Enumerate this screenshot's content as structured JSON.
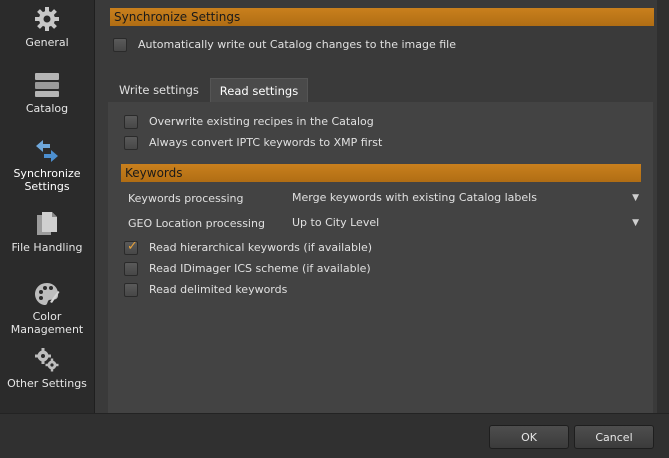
{
  "sidebar": {
    "items": [
      {
        "label": "General",
        "icon": "gear-icon"
      },
      {
        "label": "Catalog",
        "icon": "database-icon"
      },
      {
        "label": "Synchronize Settings",
        "line1": "Synchronize",
        "line2": "Settings",
        "icon": "sync-arrows-icon"
      },
      {
        "label": "File Handling",
        "icon": "files-icon"
      },
      {
        "label": "Color Management",
        "line1": "Color",
        "line2": "Management",
        "icon": "palette-icon"
      },
      {
        "label": "Other Settings",
        "icon": "gears-icon"
      }
    ]
  },
  "main": {
    "header": "Synchronize Settings",
    "auto_write_label": "Automatically write out Catalog changes to the image file",
    "auto_write_checked": false,
    "tabs": [
      {
        "label": "Write settings",
        "active": false
      },
      {
        "label": "Read settings",
        "active": true
      }
    ],
    "read": {
      "overwrite_label": "Overwrite existing recipes in the Catalog",
      "overwrite_checked": false,
      "convert_label": "Always convert IPTC keywords to XMP first",
      "convert_checked": false,
      "keywords_header": "Keywords",
      "keywords_processing_label": "Keywords processing",
      "keywords_processing_value": "Merge keywords with existing Catalog labels",
      "geo_label": "GEO Location processing",
      "geo_value": "Up to City Level",
      "hierarchical_label": "Read hierarchical keywords (if available)",
      "hierarchical_checked": true,
      "ics_label": "Read IDimager ICS scheme (if available)",
      "ics_checked": false,
      "delimited_label": "Read delimited keywords",
      "delimited_checked": false
    }
  },
  "footer": {
    "ok_label": "OK",
    "cancel_label": "Cancel"
  },
  "colors": {
    "accent": "#c57c1b",
    "background": "#3a3a3a"
  }
}
